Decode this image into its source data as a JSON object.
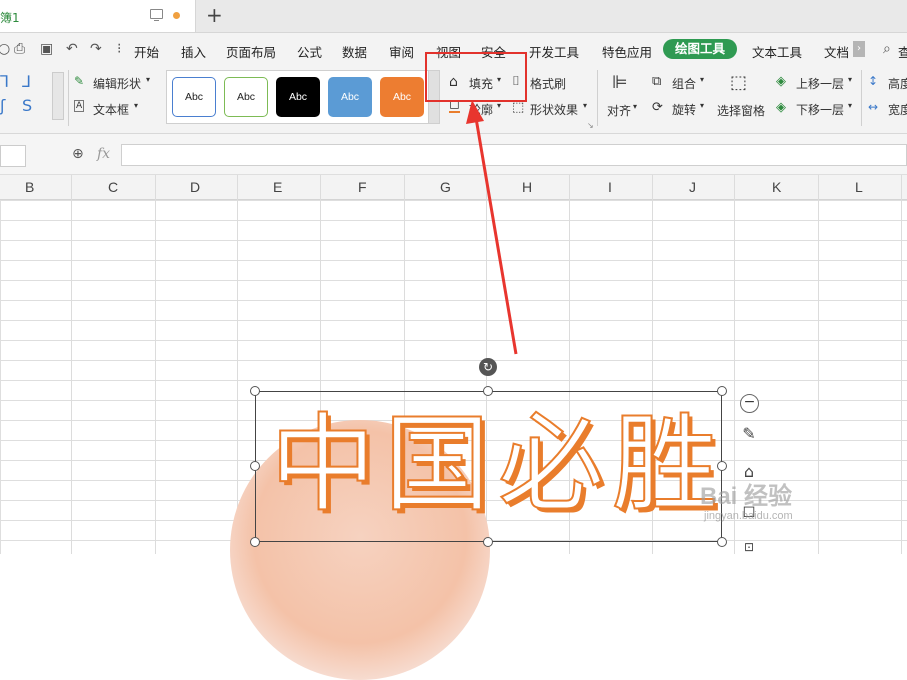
{
  "tabbar": {
    "doc_tab_title": "簿1",
    "new_tab_label": "+"
  },
  "menu": {
    "items": [
      "开始",
      "插入",
      "页面布局",
      "公式",
      "数据",
      "审阅",
      "视图",
      "安全",
      "开发工具",
      "特色应用",
      "绘图工具",
      "文本工具",
      "文档"
    ],
    "active_index": 10,
    "active_color": "#2f9a52",
    "overflow_label": "查"
  },
  "ribbon": {
    "edit_shape_label": "编辑形状",
    "text_box_label": "文本框",
    "styles": [
      {
        "label": "Abc",
        "bg": "#ffffff",
        "border": "#4a7fd0",
        "text": "#222222"
      },
      {
        "label": "Abc",
        "bg": "#ffffff",
        "border": "#7dbb55",
        "text": "#222222"
      },
      {
        "label": "Abc",
        "bg": "#000000",
        "border": "#000000",
        "text": "#ffffff"
      },
      {
        "label": "Abc",
        "bg": "#5b9bd5",
        "border": "#5b9bd5",
        "text": "#ffffff"
      },
      {
        "label": "Abc",
        "bg": "#ed7d31",
        "border": "#ed7d31",
        "text": "#ffffff"
      }
    ],
    "fill_label": "填充",
    "format_painter_label": "格式刷",
    "outline_label": "轮廓",
    "shape_effect_label": "形状效果",
    "align_label": "对齐",
    "group_label": "组合",
    "rotate_label": "旋转",
    "selection_pane_label": "选择窗格",
    "bring_forward_label": "上移一层",
    "send_backward_label": "下移一层",
    "height_label": "高度",
    "width_label": "宽度",
    "highlight_color": "#e2322c"
  },
  "formula_bar": {
    "fx_label": "fx",
    "value": ""
  },
  "columns": [
    "B",
    "C",
    "D",
    "E",
    "F",
    "G",
    "H",
    "I",
    "J",
    "K",
    "L"
  ],
  "shape": {
    "text": "中国必胜",
    "stroke_color": "#e97d2c"
  },
  "watermark": {
    "brand": "Bai 经验",
    "url": "jingyan.baidu.com"
  }
}
